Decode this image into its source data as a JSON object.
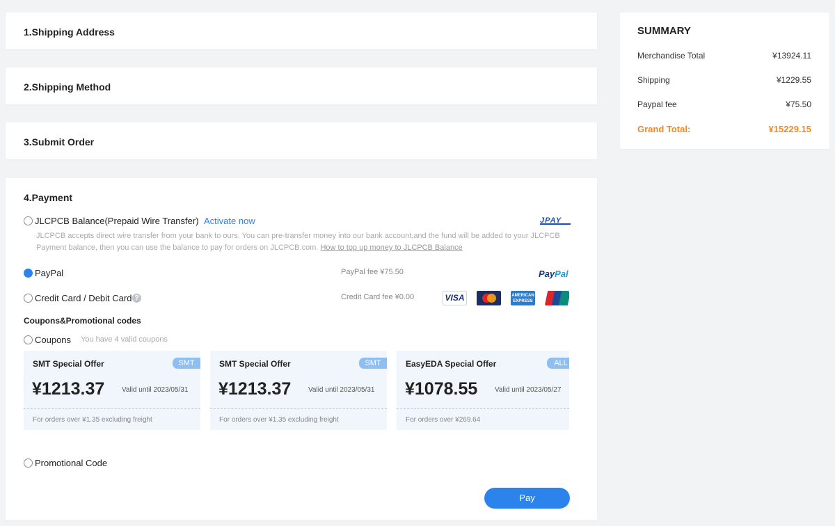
{
  "steps": {
    "shipping_address": "1.Shipping Address",
    "shipping_method": "2.Shipping Method",
    "submit_order": "3.Submit Order"
  },
  "payment": {
    "title": "4.Payment",
    "options": {
      "balance": {
        "label": "JLCPCB Balance(Prepaid Wire Transfer)",
        "activate_link": "Activate now",
        "description": "JLCPCB accepts direct wire transfer from your bank to ours. You can pre-transfer money into our bank account,and the fund will be added to your JLCPCB Payment balance, then you can use the balance to pay for orders on JLCPCB.com.",
        "help_link": "How to top up money to JLCPCB Balance",
        "logo": "JPAY",
        "selected": false
      },
      "paypal": {
        "label": "PayPal",
        "fee": "PayPal fee ¥75.50",
        "logo_pay": "Pay",
        "logo_pal": "Pal",
        "selected": true
      },
      "card": {
        "label": "Credit Card / Debit Card",
        "fee": "Credit Card fee ¥0.00",
        "selected": false,
        "logos": {
          "visa": "VISA",
          "amex": "AMERICAN EXPRESS"
        }
      }
    },
    "coupons_section": {
      "title": "Coupons&Promotional codes",
      "coupons_label": "Coupons",
      "coupons_hint": "You have 4 valid coupons",
      "coupons": [
        {
          "title": "SMT Special Offer",
          "tag": "SMT",
          "amount": "¥1213.37",
          "valid": "Valid until 2023/05/31",
          "condition": "For orders over ¥1.35 excluding freight"
        },
        {
          "title": "SMT Special Offer",
          "tag": "SMT",
          "amount": "¥1213.37",
          "valid": "Valid until 2023/05/31",
          "condition": "For orders over ¥1.35 excluding freight"
        },
        {
          "title": "EasyEDA Special Offer",
          "tag": "ALL",
          "amount": "¥1078.55",
          "valid": "Valid until 2023/05/27",
          "condition": "For orders over ¥269.64"
        }
      ],
      "promo_label": "Promotional Code"
    },
    "pay_button": "Pay"
  },
  "summary": {
    "title": "SUMMARY",
    "merchandise_label": "Merchandise Total",
    "merchandise_value": "¥13924.11",
    "shipping_label": "Shipping",
    "shipping_value": "¥1229.55",
    "paypal_fee_label": "Paypal fee",
    "paypal_fee_value": "¥75.50",
    "grand_total_label": "Grand Total:",
    "grand_total_value": "¥15229.15"
  },
  "colors": {
    "accent": "#2d83ec",
    "grand_total": "#f08a24",
    "background": "#f2f3f5"
  }
}
